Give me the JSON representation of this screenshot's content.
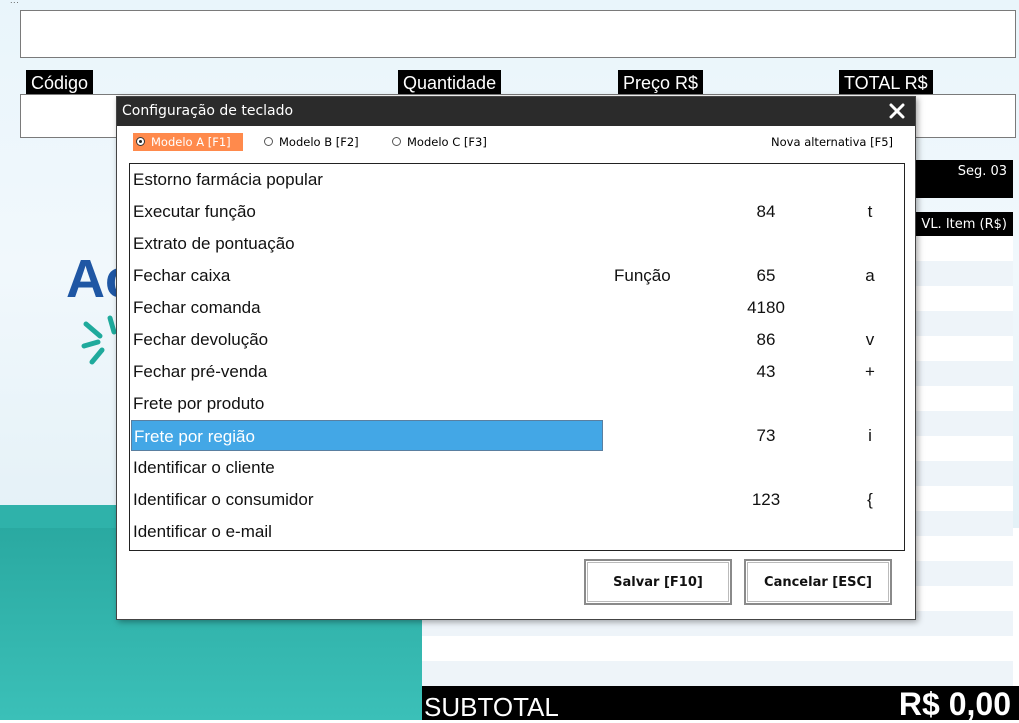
{
  "background": {
    "top_note": "...",
    "columns": {
      "codigo": "Código",
      "quantidade": "Quantidade",
      "preco": "Preço R$",
      "total": "TOTAL R$"
    },
    "side_header": "Seg. 03",
    "side_col_header": "VL. Item (R$)",
    "logo_text": "Ac",
    "subtotal_label": "SUBTOTAL",
    "subtotal_value": "R$ 0,00",
    "colors": {
      "teal": "#2fb2aa",
      "logo_blue": "#1f57a4"
    }
  },
  "dialog": {
    "title": "Configuração de teclado",
    "radios": [
      {
        "label": "Modelo A  [F1]",
        "selected": true
      },
      {
        "label": "Modelo B  [F2]",
        "selected": false
      },
      {
        "label": "Modelo C  [F3]",
        "selected": false
      }
    ],
    "alternative": "Nova alternativa [F5]",
    "rows": [
      {
        "name": "Estorno farmácia popular",
        "type": "",
        "code": "",
        "key": ""
      },
      {
        "name": "Executar função",
        "type": "",
        "code": "84",
        "key": "t"
      },
      {
        "name": "Extrato de pontuação",
        "type": "",
        "code": "",
        "key": ""
      },
      {
        "name": "Fechar caixa",
        "type": "Função",
        "code": "65",
        "key": "a"
      },
      {
        "name": "Fechar comanda",
        "type": "",
        "code": "4180",
        "key": ""
      },
      {
        "name": "Fechar devolução",
        "type": "",
        "code": "86",
        "key": "v"
      },
      {
        "name": "Fechar pré-venda",
        "type": "",
        "code": "43",
        "key": "+"
      },
      {
        "name": "Frete por produto",
        "type": "",
        "code": "",
        "key": ""
      },
      {
        "name": "Frete por região",
        "type": "",
        "code": "73",
        "key": "i",
        "selected": true
      },
      {
        "name": "Identificar o cliente",
        "type": "",
        "code": "",
        "key": ""
      },
      {
        "name": "Identificar o consumidor",
        "type": "",
        "code": "123",
        "key": "{"
      },
      {
        "name": "Identificar o e-mail",
        "type": "",
        "code": "",
        "key": ""
      }
    ],
    "save_label": "Salvar [F10]",
    "cancel_label": "Cancelar [ESC]",
    "colors": {
      "selection": "#43a7e6",
      "radio_selected": "#ff8a4c",
      "title_bar": "#2b2b2b"
    }
  }
}
